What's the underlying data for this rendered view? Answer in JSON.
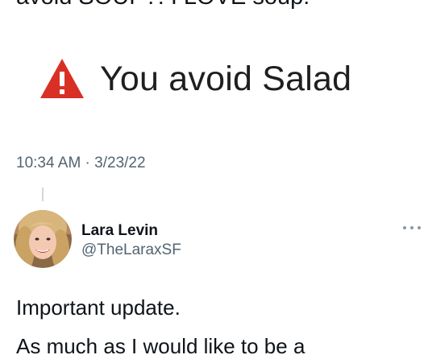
{
  "previous_tweet": {
    "text_tail": "avoid SOUP?! I LOVE soup!",
    "media_warning": {
      "icon": "warning-triangle-icon",
      "text": "You avoid Salad",
      "icon_color": "#d93025"
    },
    "timestamp": "10:34 AM · 3/23/22"
  },
  "reply_tweet": {
    "display_name": "Lara Levin",
    "handle": "@TheLaraxSF",
    "more_icon": "more-horizontal-icon",
    "text_line1": "Important update.",
    "text_line2": "As much as I would like to be a"
  },
  "colors": {
    "text_primary": "#0f1419",
    "text_secondary": "#536471",
    "thread_line": "#cfd9de"
  }
}
